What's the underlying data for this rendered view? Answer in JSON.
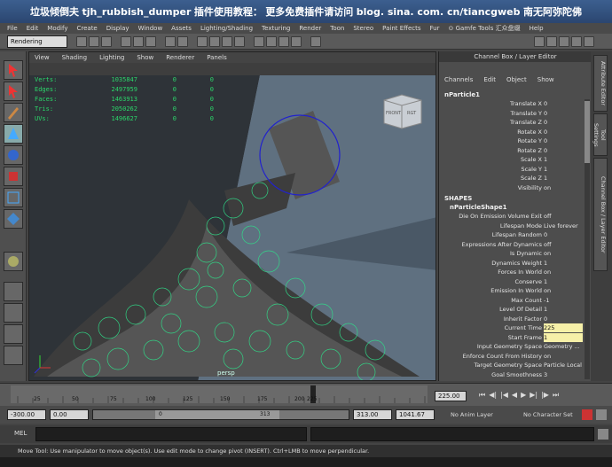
{
  "title_banner": {
    "left": "垃圾倾倒夫",
    "plugin": "tjh_rubbish_dumper",
    "tutorial": "插件使用教程：",
    "more": "更多免费插件请访问",
    "url": "blog. sina. com. cn/tiancgweb",
    "author": "南无阿弥陀佛"
  },
  "menubar": [
    "File",
    "Edit",
    "Modify",
    "Create",
    "Display",
    "Window",
    "Assets",
    "Lighting/Shading",
    "Texturing",
    "Render",
    "Toon",
    "Stereo",
    "Paint Effects",
    "Fur",
    "⊙ Gamfe Tools 汇众盘缀",
    "Help"
  ],
  "mode_select": "Rendering",
  "viewport": {
    "menu": [
      "View",
      "Shading",
      "Lighting",
      "Show",
      "Renderer",
      "Panels"
    ],
    "hud": [
      {
        "label": "Verts:",
        "v1": "1035847",
        "v2": "0",
        "v3": "0"
      },
      {
        "label": "Edges:",
        "v1": "2497959",
        "v2": "0",
        "v3": "0"
      },
      {
        "label": "Faces:",
        "v1": "1463913",
        "v2": "0",
        "v3": "0"
      },
      {
        "label": "Tris:",
        "v1": "2050262",
        "v2": "0",
        "v3": "0"
      },
      {
        "label": "UVs:",
        "v1": "1496627",
        "v2": "0",
        "v3": "0"
      }
    ],
    "viewcube_front": "FRONT",
    "viewcube_right": "RGT",
    "camera": "persp"
  },
  "channel_box": {
    "title": "Channel Box / Layer Editor",
    "menu": [
      "Channels",
      "Edit",
      "Object",
      "Show"
    ],
    "object": "nParticle1",
    "transform": [
      {
        "label": "Translate X",
        "value": "0"
      },
      {
        "label": "Translate Y",
        "value": "0"
      },
      {
        "label": "Translate Z",
        "value": "0"
      },
      {
        "label": "Rotate X",
        "value": "0"
      },
      {
        "label": "Rotate Y",
        "value": "0"
      },
      {
        "label": "Rotate Z",
        "value": "0"
      },
      {
        "label": "Scale X",
        "value": "1"
      },
      {
        "label": "Scale Y",
        "value": "1"
      },
      {
        "label": "Scale Z",
        "value": "1"
      },
      {
        "label": "Visibility",
        "value": "on"
      }
    ],
    "shapes_header": "SHAPES",
    "shape": "nParticleShape1",
    "shape_attrs": [
      {
        "label": "Die On Emission Volume Exit",
        "value": "off"
      },
      {
        "label": "Lifespan Mode",
        "value": "Live forever"
      },
      {
        "label": "Lifespan Random",
        "value": "0"
      },
      {
        "label": "Expressions After Dynamics",
        "value": "off"
      },
      {
        "label": "Is Dynamic",
        "value": "on"
      },
      {
        "label": "Dynamics Weight",
        "value": "1"
      },
      {
        "label": "Forces In World",
        "value": "on"
      },
      {
        "label": "Conserve",
        "value": "1"
      },
      {
        "label": "Emission In World",
        "value": "on"
      },
      {
        "label": "Max Count",
        "value": "-1"
      },
      {
        "label": "Level Of Detail",
        "value": "1"
      },
      {
        "label": "Inherit Factor",
        "value": "0"
      },
      {
        "label": "Current Time",
        "value": "225"
      },
      {
        "label": "Start Frame",
        "value": "1"
      },
      {
        "label": "Input Geometry Space",
        "value": "Geometry ..."
      },
      {
        "label": "Enforce Count From History",
        "value": "on"
      },
      {
        "label": "Target Geometry Space",
        "value": "Particle Local"
      },
      {
        "label": "Goal Smoothness",
        "value": "3"
      }
    ]
  },
  "side_tabs": [
    "Attribute Editor",
    "Tool Settings",
    "Channel Box / Layer Editor"
  ],
  "time_slider": {
    "ticks": [
      "25",
      "50",
      "75",
      "100",
      "125",
      "150",
      "175",
      "200",
      "225"
    ],
    "current_frame": "225",
    "current_frame_field": "225.00"
  },
  "range": {
    "start_min": "-300.00",
    "start": "0.00",
    "range_start": "0",
    "range_end": "313",
    "end": "313.00",
    "end_max": "1041.67",
    "anim_layer": "No Anim Layer",
    "character_set": "No Character Set"
  },
  "cmdline": {
    "label": "MEL"
  },
  "help_line": "Move Tool: Use manipulator to move object(s). Use edit mode to change pivot (INSERT). Ctrl+LMB to move perpendicular."
}
